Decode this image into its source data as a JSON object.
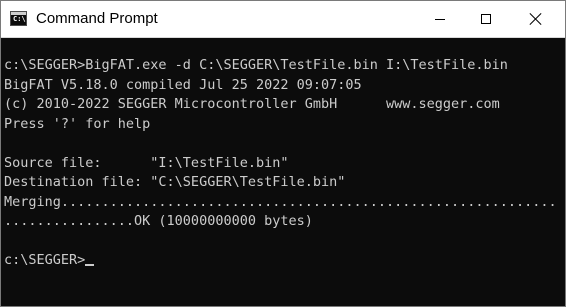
{
  "window": {
    "title": "Command Prompt",
    "icon": "command-prompt-icon",
    "icon_glyph": "C:\\"
  },
  "controls": {
    "minimize": "minimize-icon",
    "maximize": "maximize-icon",
    "close": "close-icon"
  },
  "console": {
    "background": "#0c0c0c",
    "foreground": "#cccccc",
    "lines": [
      "c:\\SEGGER>BigFAT.exe -d C:\\SEGGER\\TestFile.bin I:\\TestFile.bin",
      "BigFAT V5.18.0 compiled Jul 25 2022 09:07:05",
      "(c) 2010-2022 SEGGER Microcontroller GmbH      www.segger.com",
      "Press '?' for help",
      "",
      "Source file:      \"I:\\TestFile.bin\"",
      "Destination file: \"C:\\SEGGER\\TestFile.bin\"",
      "Merging.............................................................",
      "................OK (10000000000 bytes)",
      "",
      "c:\\SEGGER>"
    ]
  }
}
